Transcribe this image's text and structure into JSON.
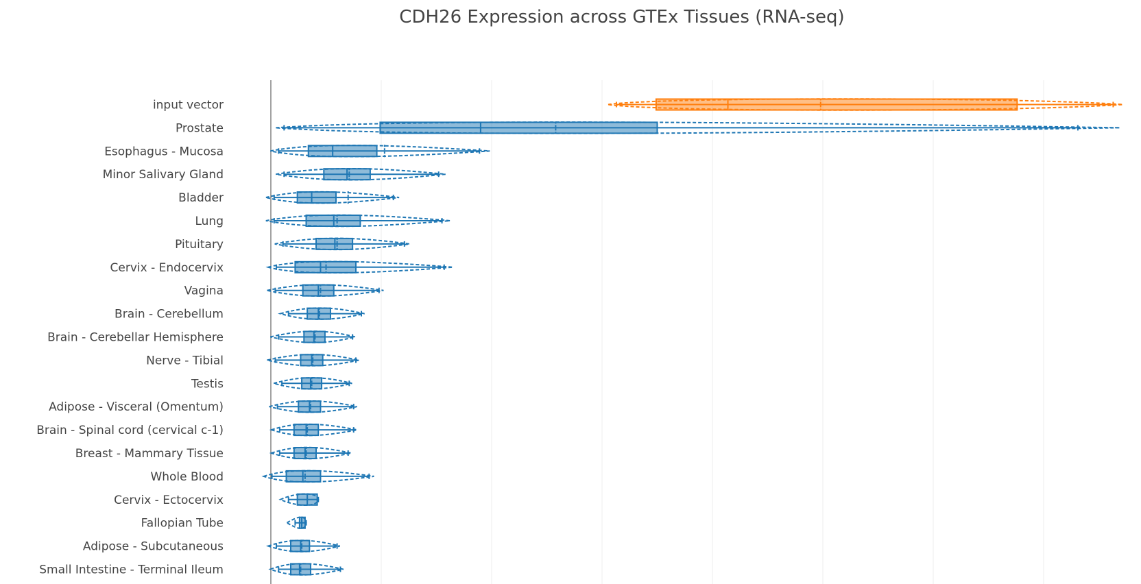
{
  "chart_data": {
    "type": "box",
    "orientation": "horizontal",
    "title": "CDH26 Expression across GTEx Tissues (RNA-seq)",
    "xlabel": "",
    "ylabel": "",
    "grid": true,
    "legend": "none",
    "colors": {
      "input": "#ff7f0e",
      "tissue": "#1f77b4"
    },
    "categories": [
      "input vector",
      "Prostate",
      "Esophagus - Mucosa",
      "Minor Salivary Gland",
      "Bladder",
      "Lung",
      "Pituitary",
      "Cervix - Endocervix",
      "Vagina",
      "Brain - Cerebellum",
      "Brain - Cerebellar Hemisphere",
      "Nerve - Tibial",
      "Testis",
      "Adipose - Visceral (Omentum)",
      "Brain - Spinal cord (cervical c-1)",
      "Breast - Mammary Tissue",
      "Whole Blood",
      "Cervix - Ectocervix",
      "Fallopian Tube",
      "Adipose - Subcutaneous",
      "Small Intestine - Terminal Ileum"
    ],
    "boxes": [
      {
        "min": 3.13,
        "q1": 3.49,
        "median": 4.14,
        "q3": 6.76,
        "max": 7.63,
        "mean": 4.98,
        "highlight": true
      },
      {
        "min": 0.12,
        "q1": 0.99,
        "median": 1.9,
        "q3": 3.5,
        "max": 7.31,
        "mean": 2.58
      },
      {
        "min": 0.07,
        "q1": 0.34,
        "median": 0.56,
        "q3": 0.96,
        "max": 1.89,
        "mean": 1.03
      },
      {
        "min": 0.12,
        "q1": 0.48,
        "median": 0.69,
        "q3": 0.9,
        "max": 1.52,
        "mean": 0.71
      },
      {
        "min": 0.03,
        "q1": 0.24,
        "median": 0.37,
        "q3": 0.59,
        "max": 1.11,
        "mean": 0.7
      },
      {
        "min": 0.03,
        "q1": 0.32,
        "median": 0.57,
        "q3": 0.81,
        "max": 1.55,
        "mean": 0.6
      },
      {
        "min": 0.11,
        "q1": 0.41,
        "median": 0.58,
        "q3": 0.74,
        "max": 1.21,
        "mean": 0.6
      },
      {
        "min": 0.05,
        "q1": 0.22,
        "median": 0.45,
        "q3": 0.77,
        "max": 1.57,
        "mean": 0.5
      },
      {
        "min": 0.04,
        "q1": 0.29,
        "median": 0.43,
        "q3": 0.57,
        "max": 0.98,
        "mean": 0.45
      },
      {
        "min": 0.16,
        "q1": 0.33,
        "median": 0.43,
        "q3": 0.54,
        "max": 0.82,
        "mean": 0.44
      },
      {
        "min": 0.07,
        "q1": 0.3,
        "median": 0.39,
        "q3": 0.49,
        "max": 0.74,
        "mean": 0.4
      },
      {
        "min": 0.04,
        "q1": 0.27,
        "median": 0.37,
        "q3": 0.47,
        "max": 0.77,
        "mean": 0.38
      },
      {
        "min": 0.1,
        "q1": 0.28,
        "median": 0.36,
        "q3": 0.46,
        "max": 0.71,
        "mean": 0.37
      },
      {
        "min": 0.06,
        "q1": 0.25,
        "median": 0.35,
        "q3": 0.45,
        "max": 0.75,
        "mean": 0.36
      },
      {
        "min": 0.08,
        "q1": 0.21,
        "median": 0.32,
        "q3": 0.43,
        "max": 0.75,
        "mean": 0.33
      },
      {
        "min": 0.08,
        "q1": 0.21,
        "median": 0.31,
        "q3": 0.41,
        "max": 0.7,
        "mean": 0.32
      },
      {
        "min": 0.01,
        "q1": 0.14,
        "median": 0.29,
        "q3": 0.45,
        "max": 0.89,
        "mean": 0.31
      },
      {
        "min": 0.16,
        "q1": 0.24,
        "median": 0.33,
        "q3": 0.42,
        "max": 0.43,
        "mean": 0.33
      },
      {
        "min": 0.22,
        "q1": 0.26,
        "median": 0.28,
        "q3": 0.31,
        "max": 0.32,
        "mean": 0.28
      },
      {
        "min": 0.05,
        "q1": 0.18,
        "median": 0.27,
        "q3": 0.35,
        "max": 0.6,
        "mean": 0.28
      },
      {
        "min": 0.07,
        "q1": 0.18,
        "median": 0.26,
        "q3": 0.36,
        "max": 0.63,
        "mean": 0.27
      }
    ],
    "xlim": [
      0,
      8.2
    ]
  }
}
